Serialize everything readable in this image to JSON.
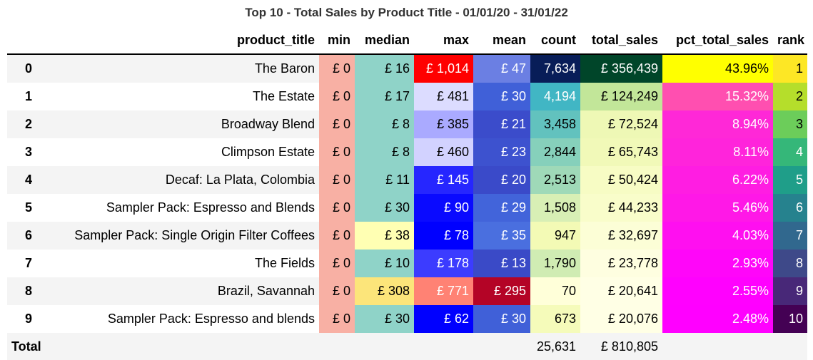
{
  "title": "Top 10 - Total Sales by Product Title - 01/01/20 - 31/01/22",
  "chart_data": {
    "type": "table",
    "title": "Top 10 - Total Sales by Product Title - 01/01/20 - 31/01/22",
    "columns": [
      "product_title",
      "min",
      "median",
      "max",
      "mean",
      "count",
      "total_sales",
      "pct_total_sales",
      "rank"
    ],
    "rows": [
      {
        "index": "0",
        "product_title": "The Baron",
        "min": "£ 0",
        "median": "£ 16",
        "max": "£ 1,014",
        "mean": "£ 47",
        "count": "7,634",
        "total_sales": "£ 356,439",
        "pct_total_sales": "43.96%",
        "rank": "1"
      },
      {
        "index": "1",
        "product_title": "The Estate",
        "min": "£ 0",
        "median": "£ 17",
        "max": "£ 481",
        "mean": "£ 30",
        "count": "4,194",
        "total_sales": "£ 124,249",
        "pct_total_sales": "15.32%",
        "rank": "2"
      },
      {
        "index": "2",
        "product_title": "Broadway Blend",
        "min": "£ 0",
        "median": "£ 8",
        "max": "£ 385",
        "mean": "£ 21",
        "count": "3,458",
        "total_sales": "£ 72,524",
        "pct_total_sales": "8.94%",
        "rank": "3"
      },
      {
        "index": "3",
        "product_title": "Climpson Estate",
        "min": "£ 0",
        "median": "£ 8",
        "max": "£ 460",
        "mean": "£ 23",
        "count": "2,844",
        "total_sales": "£ 65,743",
        "pct_total_sales": "8.11%",
        "rank": "4"
      },
      {
        "index": "4",
        "product_title": "Decaf: La Plata, Colombia",
        "min": "£ 0",
        "median": "£ 11",
        "max": "£ 145",
        "mean": "£ 20",
        "count": "2,513",
        "total_sales": "£ 50,424",
        "pct_total_sales": "6.22%",
        "rank": "5"
      },
      {
        "index": "5",
        "product_title": "Sampler Pack: Espresso and Blends",
        "min": "£ 0",
        "median": "£ 30",
        "max": "£ 90",
        "mean": "£ 29",
        "count": "1,508",
        "total_sales": "£ 44,233",
        "pct_total_sales": "5.46%",
        "rank": "6"
      },
      {
        "index": "6",
        "product_title": "Sampler Pack: Single Origin Filter Coffees",
        "min": "£ 0",
        "median": "£ 38",
        "max": "£ 78",
        "mean": "£ 35",
        "count": "947",
        "total_sales": "£ 32,697",
        "pct_total_sales": "4.03%",
        "rank": "7"
      },
      {
        "index": "7",
        "product_title": "The Fields",
        "min": "£ 0",
        "median": "£ 10",
        "max": "£ 178",
        "mean": "£ 13",
        "count": "1,790",
        "total_sales": "£ 23,778",
        "pct_total_sales": "2.93%",
        "rank": "8"
      },
      {
        "index": "8",
        "product_title": "Brazil, Savannah",
        "min": "£ 0",
        "median": "£ 308",
        "max": "£ 771",
        "mean": "£ 295",
        "count": "70",
        "total_sales": "£ 20,641",
        "pct_total_sales": "2.55%",
        "rank": "9"
      },
      {
        "index": "9",
        "product_title": "Sampler Pack: Espresso and blends",
        "min": "£ 0",
        "median": "£ 30",
        "max": "£ 62",
        "mean": "£ 30",
        "count": "673",
        "total_sales": "£ 20,076",
        "pct_total_sales": "2.48%",
        "rank": "10"
      }
    ],
    "total": {
      "label": "Total",
      "count": "25,631",
      "total_sales": "£ 810,805"
    }
  },
  "cell_colors": {
    "min": [
      {
        "bg": "#f8b0a4",
        "fg": "#000000"
      },
      {
        "bg": "#f8b0a4",
        "fg": "#000000"
      },
      {
        "bg": "#f8b0a4",
        "fg": "#000000"
      },
      {
        "bg": "#f8b0a4",
        "fg": "#000000"
      },
      {
        "bg": "#f8b0a4",
        "fg": "#000000"
      },
      {
        "bg": "#f8b0a4",
        "fg": "#000000"
      },
      {
        "bg": "#f8b0a4",
        "fg": "#000000"
      },
      {
        "bg": "#f8b0a4",
        "fg": "#000000"
      },
      {
        "bg": "#f8b0a4",
        "fg": "#000000"
      },
      {
        "bg": "#f8b0a4",
        "fg": "#000000"
      }
    ],
    "median": [
      {
        "bg": "#8fd3c8",
        "fg": "#000000"
      },
      {
        "bg": "#8fd3c8",
        "fg": "#000000"
      },
      {
        "bg": "#8fd3c8",
        "fg": "#000000"
      },
      {
        "bg": "#8fd3c8",
        "fg": "#000000"
      },
      {
        "bg": "#8fd3c8",
        "fg": "#000000"
      },
      {
        "bg": "#8fd3c8",
        "fg": "#000000"
      },
      {
        "bg": "#ffffb3",
        "fg": "#000000"
      },
      {
        "bg": "#8fd3c8",
        "fg": "#000000"
      },
      {
        "bg": "#fce57a",
        "fg": "#000000"
      },
      {
        "bg": "#8fd3c8",
        "fg": "#000000"
      }
    ],
    "max": [
      {
        "bg": "#ff0000",
        "fg": "#ffffff"
      },
      {
        "bg": "#dcdcff",
        "fg": "#000000"
      },
      {
        "bg": "#aaaaff",
        "fg": "#000000"
      },
      {
        "bg": "#d2d2ff",
        "fg": "#000000"
      },
      {
        "bg": "#2626ff",
        "fg": "#ffffff"
      },
      {
        "bg": "#0a0aff",
        "fg": "#ffffff"
      },
      {
        "bg": "#0000ff",
        "fg": "#ffffff"
      },
      {
        "bg": "#3c3cff",
        "fg": "#ffffff"
      },
      {
        "bg": "#ff8274",
        "fg": "#ffffff"
      },
      {
        "bg": "#0000ff",
        "fg": "#ffffff"
      }
    ],
    "mean": [
      {
        "bg": "#6b7fe3",
        "fg": "#ffffff"
      },
      {
        "bg": "#4060d8",
        "fg": "#ffffff"
      },
      {
        "bg": "#3b4ccb",
        "fg": "#ffffff"
      },
      {
        "bg": "#3d52cf",
        "fg": "#ffffff"
      },
      {
        "bg": "#3a4ac9",
        "fg": "#ffffff"
      },
      {
        "bg": "#4264da",
        "fg": "#ffffff"
      },
      {
        "bg": "#4a6fdf",
        "fg": "#ffffff"
      },
      {
        "bg": "#3a4ac7",
        "fg": "#ffffff"
      },
      {
        "bg": "#b40426",
        "fg": "#ffffff"
      },
      {
        "bg": "#4060d8",
        "fg": "#ffffff"
      }
    ],
    "count": [
      {
        "bg": "#081d58",
        "fg": "#ffffff"
      },
      {
        "bg": "#41b6c4",
        "fg": "#ffffff"
      },
      {
        "bg": "#62c2be",
        "fg": "#000000"
      },
      {
        "bg": "#86d0bb",
        "fg": "#000000"
      },
      {
        "bg": "#9fd9b8",
        "fg": "#000000"
      },
      {
        "bg": "#d8efb5",
        "fg": "#000000"
      },
      {
        "bg": "#f3fab5",
        "fg": "#000000"
      },
      {
        "bg": "#d0ecb3",
        "fg": "#000000"
      },
      {
        "bg": "#ffffd9",
        "fg": "#000000"
      },
      {
        "bg": "#f5fbba",
        "fg": "#000000"
      }
    ],
    "total_sales": [
      {
        "bg": "#004529",
        "fg": "#ffffff"
      },
      {
        "bg": "#c2e699",
        "fg": "#000000"
      },
      {
        "bg": "#eef8b5",
        "fg": "#000000"
      },
      {
        "bg": "#f1f9b8",
        "fg": "#000000"
      },
      {
        "bg": "#f7fcc4",
        "fg": "#000000"
      },
      {
        "bg": "#f9fdca",
        "fg": "#000000"
      },
      {
        "bg": "#fcfed6",
        "fg": "#000000"
      },
      {
        "bg": "#fefee0",
        "fg": "#000000"
      },
      {
        "bg": "#ffffe5",
        "fg": "#000000"
      },
      {
        "bg": "#ffffe5",
        "fg": "#000000"
      }
    ],
    "pct_total_sales": [
      {
        "bg": "#ffff00",
        "fg": "#000000"
      },
      {
        "bg": "#ff4fb0",
        "fg": "#ffffff"
      },
      {
        "bg": "#ff28d7",
        "fg": "#ffffff"
      },
      {
        "bg": "#ff24db",
        "fg": "#ffffff"
      },
      {
        "bg": "#ff1de2",
        "fg": "#ffffff"
      },
      {
        "bg": "#ff18e7",
        "fg": "#ffffff"
      },
      {
        "bg": "#ff0ff0",
        "fg": "#ffffff"
      },
      {
        "bg": "#ff06f9",
        "fg": "#ffffff"
      },
      {
        "bg": "#ff01fe",
        "fg": "#ffffff"
      },
      {
        "bg": "#ff00ff",
        "fg": "#ffffff"
      }
    ],
    "rank": [
      {
        "bg": "#fde725",
        "fg": "#000000"
      },
      {
        "bg": "#b5de2b",
        "fg": "#000000"
      },
      {
        "bg": "#6ccd5a",
        "fg": "#000000"
      },
      {
        "bg": "#35b779",
        "fg": "#ffffff"
      },
      {
        "bg": "#1f9e89",
        "fg": "#ffffff"
      },
      {
        "bg": "#26828e",
        "fg": "#ffffff"
      },
      {
        "bg": "#31688e",
        "fg": "#ffffff"
      },
      {
        "bg": "#3e4989",
        "fg": "#ffffff"
      },
      {
        "bg": "#482878",
        "fg": "#ffffff"
      },
      {
        "bg": "#440154",
        "fg": "#ffffff"
      }
    ]
  }
}
